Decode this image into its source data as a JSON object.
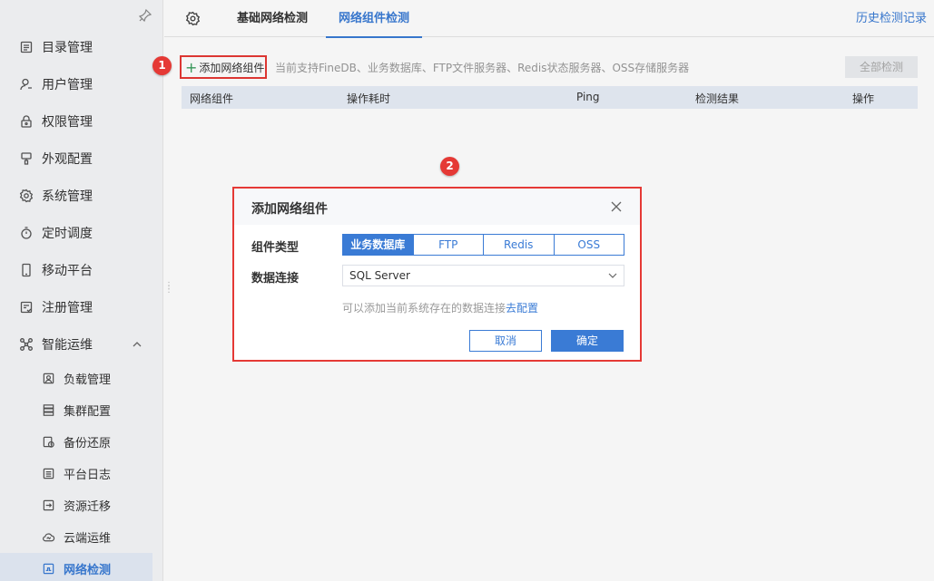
{
  "sidebar": {
    "items": [
      {
        "label": "目录管理",
        "icon": "catalog-icon"
      },
      {
        "label": "用户管理",
        "icon": "user-icon"
      },
      {
        "label": "权限管理",
        "icon": "lock-icon"
      },
      {
        "label": "外观配置",
        "icon": "brush-icon"
      },
      {
        "label": "系统管理",
        "icon": "gear-icon"
      },
      {
        "label": "定时调度",
        "icon": "timer-icon"
      },
      {
        "label": "移动平台",
        "icon": "mobile-icon"
      },
      {
        "label": "注册管理",
        "icon": "register-icon"
      },
      {
        "label": "智能运维",
        "icon": "ops-icon"
      }
    ],
    "subitems": [
      {
        "label": "负载管理",
        "icon": "load-icon"
      },
      {
        "label": "集群配置",
        "icon": "cluster-icon"
      },
      {
        "label": "备份还原",
        "icon": "backup-icon"
      },
      {
        "label": "平台日志",
        "icon": "log-icon"
      },
      {
        "label": "资源迁移",
        "icon": "migrate-icon"
      },
      {
        "label": "云端运维",
        "icon": "cloud-icon"
      },
      {
        "label": "网络检测",
        "icon": "network-icon"
      }
    ]
  },
  "topbar": {
    "tabs": [
      "基础网络检测",
      "网络组件检测"
    ],
    "active_tab": "网络组件检测",
    "history_link": "历史检测记录"
  },
  "toolbar": {
    "add_button": "添加网络组件",
    "hint": "当前支持FineDB、业务数据库、FTP文件服务器、Redis状态服务器、OSS存储服务器",
    "check_all": "全部检测"
  },
  "table": {
    "columns": [
      "网络组件",
      "操作耗时",
      "Ping",
      "检测结果",
      "操作"
    ]
  },
  "badges": [
    "1",
    "2"
  ],
  "dialog": {
    "title": "添加网络组件",
    "type_label": "组件类型",
    "types": [
      "业务数据库",
      "FTP",
      "Redis",
      "OSS"
    ],
    "selected_type": "业务数据库",
    "connection_label": "数据连接",
    "connection_value": "SQL Server",
    "tip_text": "可以添加当前系统存在的数据连接",
    "tip_link": "去配置",
    "cancel": "取消",
    "confirm": "确定"
  },
  "colors": {
    "accent": "#3a7bd5",
    "annotation": "#e53935"
  }
}
